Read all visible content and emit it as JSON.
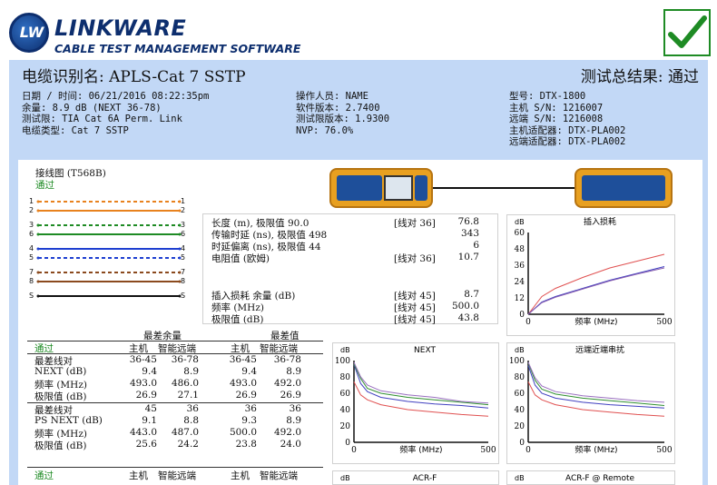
{
  "header": {
    "logo_mark": "LW",
    "brand": "LINKWARE",
    "brand_sub": "CABLE TEST MANAGEMENT SOFTWARE",
    "cable_id": "电缆识别名: APLS-Cat 7 SSTP",
    "overall_result": "测试总结果: 通过",
    "pass_icon": "check-icon",
    "pass_color": "#1e8b24"
  },
  "info": {
    "col1": [
      "日期 / 时间: 06/21/2016 08:22:35pm",
      "余量: 8.9 dB (NEXT 36-78)",
      "测试限: TIA Cat 6A Perm. Link",
      "电缆类型: Cat 7 SSTP"
    ],
    "col2": [
      "操作人员: NAME",
      "软件版本: 2.7400",
      "测试限版本: 1.9300",
      "NVP: 76.0%"
    ],
    "col3": [
      "型号: DTX-1800",
      "主机 S/N: 1216007",
      "远端 S/N: 1216008",
      "主机适配器: DTX-PLA002",
      "远端适配器: DTX-PLA002"
    ]
  },
  "wiremap": {
    "title": "接线图 (T568B)",
    "status": "通过",
    "pins": [
      "1",
      "2",
      "3",
      "6",
      "4",
      "5",
      "7",
      "8",
      "S"
    ]
  },
  "measures": {
    "rows": [
      {
        "label": "长度 (m), 极限值 90.0",
        "pair": "[线对 36]",
        "value": "76.8"
      },
      {
        "label": "传输时延 (ns), 极限值 498",
        "pair": "",
        "value": "343"
      },
      {
        "label": "时延偏离 (ns), 极限值 44",
        "pair": "",
        "value": "6"
      },
      {
        "label": "电阻值 (欧姆)",
        "pair": "[线对 36]",
        "value": "10.7"
      }
    ],
    "rows2": [
      {
        "label": "插入损耗 余量 (dB)",
        "pair": "[线对 45]",
        "value": "8.7"
      },
      {
        "label": "频率 (MHz)",
        "pair": "[线对 45]",
        "value": "500.0"
      },
      {
        "label": "极限值 (dB)",
        "pair": "[线对 45]",
        "value": "43.8"
      }
    ]
  },
  "worst": {
    "h_margin": "最差余量",
    "h_value": "最差值",
    "pass": "通过",
    "main": "主机",
    "remote": "智能远端",
    "block1": [
      [
        "最差线对",
        "36-45",
        "36-78",
        "36-45",
        "36-78"
      ],
      [
        "NEXT (dB)",
        "9.4",
        "8.9",
        "9.4",
        "8.9"
      ],
      [
        "频率 (MHz)",
        "493.0",
        "486.0",
        "493.0",
        "492.0"
      ],
      [
        "极限值 (dB)",
        "26.9",
        "27.1",
        "26.9",
        "26.9"
      ]
    ],
    "block2": [
      [
        "最差线对",
        "45",
        "36",
        "36",
        "36"
      ],
      [
        "PS NEXT (dB)",
        "9.1",
        "8.8",
        "9.3",
        "8.9"
      ],
      [
        "频率 (MHz)",
        "443.0",
        "487.0",
        "500.0",
        "492.0"
      ],
      [
        "极限值 (dB)",
        "25.6",
        "24.2",
        "23.8",
        "24.0"
      ]
    ],
    "pass2": "通过",
    "main2": "主机",
    "remote2": "智能远端",
    "main3": "主机",
    "remote3": "智能远端"
  },
  "chart_data": [
    {
      "type": "line",
      "title": "插入损耗",
      "ylabel": "dB",
      "xlabel": "频率 (MHz)",
      "xlim": [
        0,
        500
      ],
      "ylim": [
        0,
        60
      ],
      "yticks": [
        0,
        12,
        24,
        36,
        48,
        60
      ],
      "xticks": [
        0,
        500
      ],
      "series": [
        {
          "color": "#e05050",
          "x": [
            0,
            50,
            100,
            200,
            300,
            400,
            500
          ],
          "y": [
            0,
            13,
            19,
            27,
            34,
            39,
            44
          ]
        },
        {
          "color": "#4040c0",
          "x": [
            0,
            50,
            100,
            200,
            300,
            400,
            500
          ],
          "y": [
            0,
            9,
            13,
            19,
            25,
            30,
            35
          ]
        },
        {
          "color": "#8a5fb0",
          "x": [
            0,
            50,
            100,
            200,
            300,
            400,
            500
          ],
          "y": [
            0,
            8.5,
            12.5,
            18.5,
            24.5,
            29.5,
            34
          ]
        }
      ]
    },
    {
      "type": "line",
      "title": "NEXT",
      "ylabel": "dB",
      "xlabel": "频率 (MHz)",
      "xlim": [
        0,
        500
      ],
      "ylim": [
        0,
        100
      ],
      "yticks": [
        0,
        20,
        40,
        60,
        80,
        100
      ],
      "xticks": [
        0,
        500
      ],
      "series": [
        {
          "color": "#e05050",
          "x": [
            0,
            25,
            50,
            100,
            200,
            300,
            400,
            500
          ],
          "y": [
            74,
            58,
            52,
            46,
            40,
            37,
            34,
            32
          ]
        },
        {
          "color": "#4040c0",
          "x": [
            0,
            25,
            50,
            100,
            200,
            300,
            400,
            500
          ],
          "y": [
            95,
            72,
            62,
            55,
            50,
            47,
            45,
            42
          ]
        },
        {
          "color": "#2f8f2f",
          "x": [
            0,
            25,
            50,
            100,
            200,
            300,
            400,
            500
          ],
          "y": [
            96,
            78,
            66,
            60,
            55,
            52,
            49,
            46
          ]
        },
        {
          "color": "#9a6fc0",
          "x": [
            0,
            25,
            50,
            100,
            200,
            300,
            400,
            500
          ],
          "y": [
            98,
            80,
            70,
            63,
            58,
            55,
            50,
            48
          ]
        }
      ]
    },
    {
      "type": "line",
      "title": "远端近端串扰",
      "ylabel": "dB",
      "xlabel": "频率 (MHz)",
      "xlim": [
        0,
        500
      ],
      "ylim": [
        0,
        100
      ],
      "yticks": [
        0,
        20,
        40,
        60,
        80,
        100
      ],
      "xticks": [
        0,
        500
      ],
      "series": [
        {
          "color": "#e05050",
          "x": [
            0,
            25,
            50,
            100,
            200,
            300,
            400,
            500
          ],
          "y": [
            74,
            58,
            52,
            46,
            40,
            37,
            34,
            32
          ]
        },
        {
          "color": "#4040c0",
          "x": [
            0,
            25,
            50,
            100,
            200,
            300,
            400,
            500
          ],
          "y": [
            94,
            70,
            60,
            54,
            49,
            46,
            44,
            42
          ]
        },
        {
          "color": "#2f8f2f",
          "x": [
            0,
            25,
            50,
            100,
            200,
            300,
            400,
            500
          ],
          "y": [
            97,
            76,
            65,
            59,
            54,
            51,
            48,
            45
          ]
        },
        {
          "color": "#9a6fc0",
          "x": [
            0,
            25,
            50,
            100,
            200,
            300,
            400,
            500
          ],
          "y": [
            98,
            79,
            69,
            62,
            57,
            54,
            51,
            49
          ]
        }
      ]
    },
    {
      "type": "line",
      "title": "ACR-F",
      "ylabel": "dB",
      "series": []
    },
    {
      "type": "line",
      "title": "ACR-F @ Remote",
      "ylabel": "dB",
      "series": []
    }
  ],
  "colors": {
    "band": "#c2d8f6",
    "brand": "#0d2e6e"
  }
}
